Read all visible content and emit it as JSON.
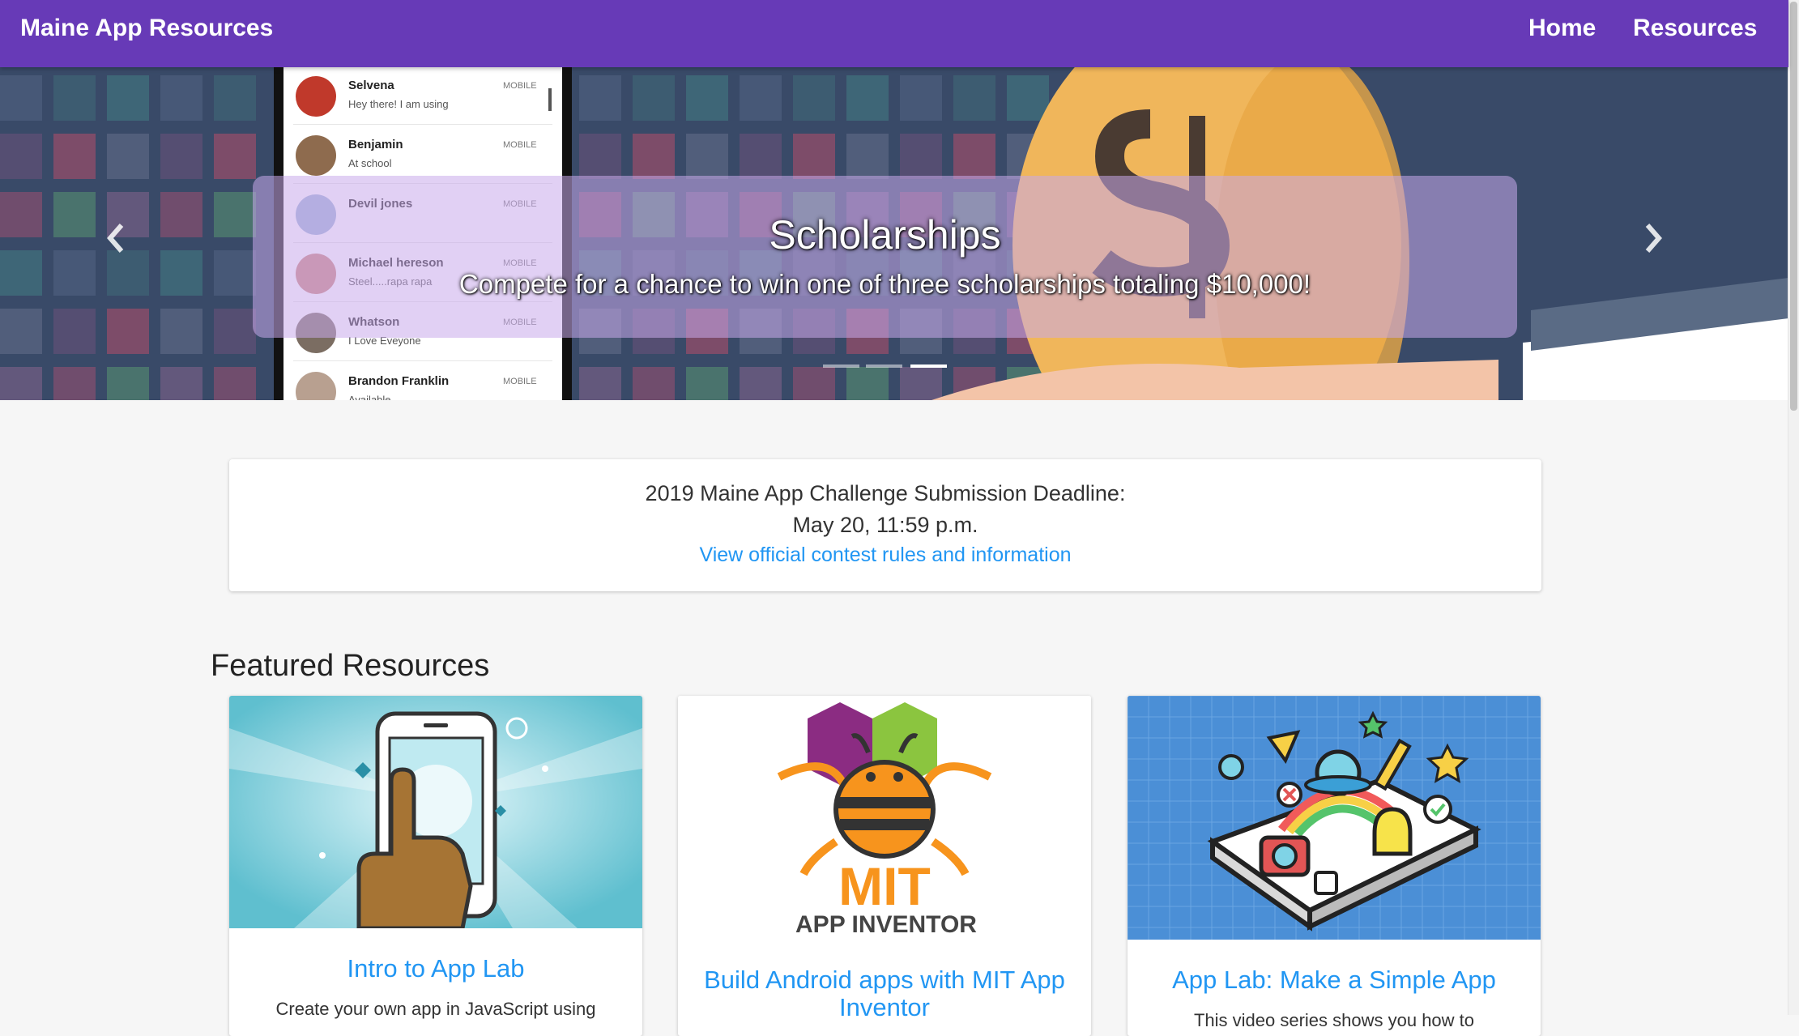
{
  "navbar": {
    "brand": "Maine App Resources",
    "links": [
      {
        "label": "Home"
      },
      {
        "label": "Resources"
      }
    ],
    "color": "#673ab7"
  },
  "carousel": {
    "title": "Scholarships",
    "text": "Compete for a chance to win one of three scholarships totaling $10,000!",
    "indicators": 3,
    "active_index": 2,
    "prev_icon": "chevron-left-icon",
    "next_icon": "chevron-right-icon",
    "contacts": [
      {
        "name": "Selvena",
        "status": "Hey there! I am using",
        "tag": "MOBILE"
      },
      {
        "name": "Benjamin",
        "status": "At school",
        "tag": "MOBILE"
      },
      {
        "name": "Devil jones",
        "status": "",
        "tag": "MOBILE"
      },
      {
        "name": "Michael hereson",
        "status": "Steel.....rapa rapa",
        "tag": "MOBILE"
      },
      {
        "name": "Whatson",
        "status": "I Love Eveyone",
        "tag": "MOBILE"
      },
      {
        "name": "Brandon Franklin",
        "status": "Available",
        "tag": "MOBILE"
      }
    ]
  },
  "deadline": {
    "line1": "2019 Maine App Challenge Submission Deadline:",
    "line2": "May 20, 11:59 p.m.",
    "link": "View official contest rules and information"
  },
  "featured": {
    "title": "Featured Resources",
    "cards": [
      {
        "title": "Intro to App Lab",
        "text": "Create your own app in JavaScript using"
      },
      {
        "title": "Build Android apps with MIT App Inventor",
        "text": "",
        "logo_text": "MIT",
        "logo_subtext": "APP INVENTOR"
      },
      {
        "title": "App Lab: Make a Simple App",
        "text": "This video series shows you how to"
      }
    ]
  },
  "colors": {
    "accent": "#673ab7",
    "link": "#2196f3",
    "background": "#f6f6f6"
  }
}
